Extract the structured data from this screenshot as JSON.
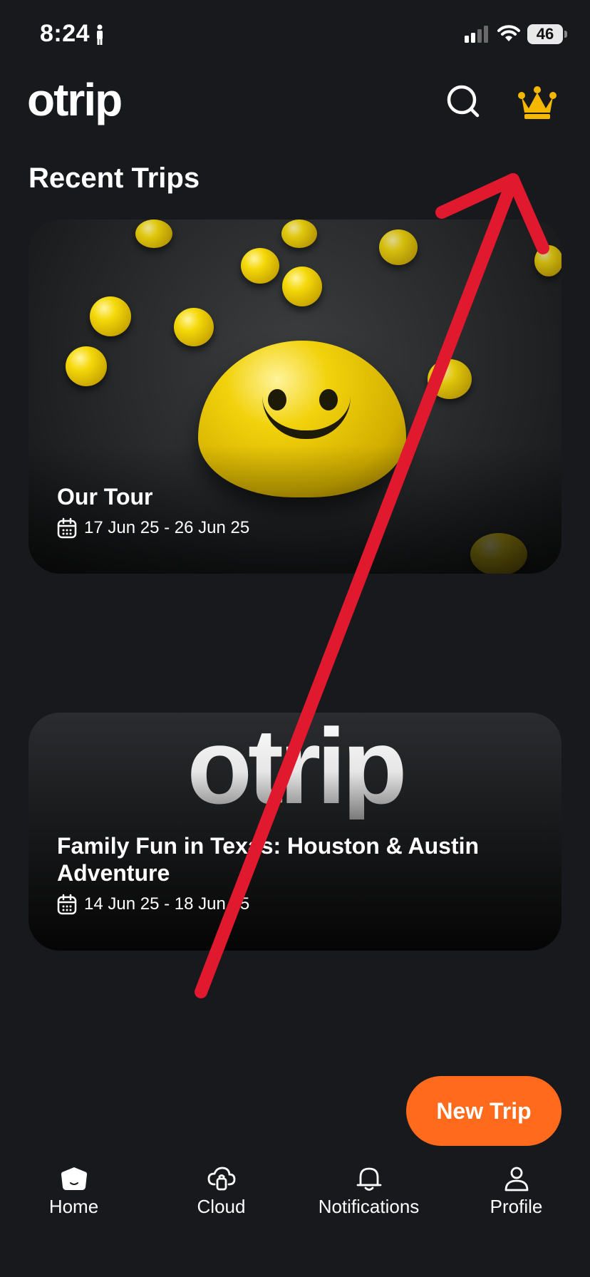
{
  "status_bar": {
    "time": "8:24",
    "battery": "46"
  },
  "header": {
    "logo": "otrip"
  },
  "section": {
    "title": "Recent Trips"
  },
  "trips": [
    {
      "title": "Our Tour",
      "dates": "17 Jun 25 - 26 Jun 25"
    },
    {
      "title": "Family Fun in Texas: Houston & Austin Adventure",
      "dates": "14 Jun 25 - 18 Jun 25",
      "cover_text": "otrip"
    }
  ],
  "fab": {
    "label": "New Trip"
  },
  "bottom_nav": [
    {
      "label": "Home",
      "icon": "home-icon",
      "active": true
    },
    {
      "label": "Cloud",
      "icon": "cloud-icon",
      "active": false
    },
    {
      "label": "Notifications",
      "icon": "bell-icon",
      "active": false
    },
    {
      "label": "Profile",
      "icon": "user-icon",
      "active": false
    }
  ],
  "colors": {
    "background": "#17191c",
    "accent": "#ff6a1c",
    "crown": "#f5b800",
    "annotation_arrow": "#e0192f"
  }
}
